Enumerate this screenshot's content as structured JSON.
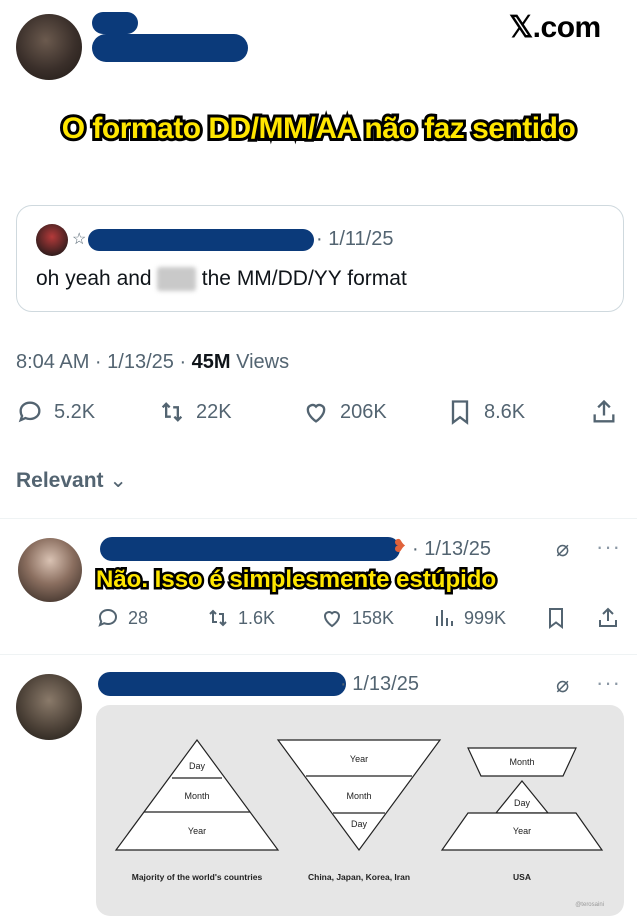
{
  "header": {
    "brand": "𝕏.com",
    "caption": "O formato DD/MM/AA não faz sentido"
  },
  "quoted_post": {
    "date": "· 1/11/25",
    "text_before": "oh yeah and ",
    "censored_word": "fuck",
    "text_after": " the MM/DD/YY format"
  },
  "post_meta": {
    "time": "8:04 AM · 1/13/25 · ",
    "views_count": "45M",
    "views_label": " Views"
  },
  "post_actions": {
    "replies": "5.2K",
    "reposts": "22K",
    "likes": "206K",
    "bookmarks": "8.6K"
  },
  "sort": {
    "label": "Relevant"
  },
  "replies": [
    {
      "date": "· 1/13/25",
      "caption": "Não. Isso é simplesmente estúpido",
      "replies": "28",
      "reposts": "1.6K",
      "likes": "158K",
      "views": "999K"
    },
    {
      "date": "· 1/13/25"
    }
  ],
  "diagram": {
    "pyramid1": {
      "top": "Day",
      "mid": "Month",
      "bottom": "Year",
      "caption": "Majority of the world's countries"
    },
    "pyramid2": {
      "top": "Year",
      "mid": "Month",
      "bottom": "Day",
      "caption": "China, Japan, Korea, Iran"
    },
    "pyramid3": {
      "top": "Month",
      "mid": "Day",
      "bottom": "Year",
      "caption": "USA"
    },
    "credit": "@terosaini"
  },
  "colors": {
    "caption_yellow": "#ffe600",
    "redaction_blue": "#0b3a7a",
    "muted": "#536471"
  }
}
